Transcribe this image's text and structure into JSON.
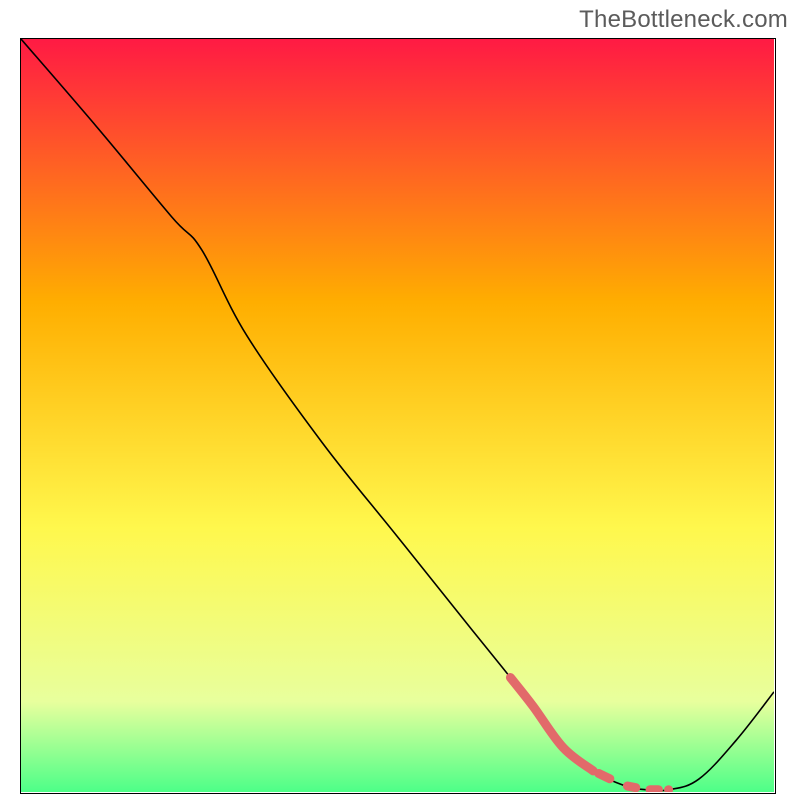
{
  "watermark": "TheBottleneck.com",
  "chart_data": {
    "type": "line",
    "title": "",
    "xlabel": "",
    "ylabel": "",
    "xlim": [
      0,
      100
    ],
    "ylim": [
      0,
      100
    ],
    "grid": false,
    "background": "gradient",
    "gradient_colors": [
      "#ff1a44",
      "#ffae00",
      "#fff84d",
      "#e8ff9d",
      "#4dff88"
    ],
    "series": [
      {
        "name": "curve",
        "type": "line",
        "color": "#000000",
        "x": [
          0,
          10,
          20,
          24,
          30,
          40,
          50,
          60,
          65,
          68,
          72,
          76,
          80,
          83,
          86,
          90,
          95,
          100
        ],
        "y": [
          100,
          88.4,
          76.4,
          72,
          60.6,
          46.4,
          33.9,
          21.4,
          15.2,
          11.4,
          5.9,
          2.8,
          0.9,
          0.3,
          0.3,
          1.7,
          6.9,
          13.3
        ]
      },
      {
        "name": "highlight",
        "type": "line",
        "color": "#e26a6a",
        "style": "thick-dash-dot",
        "x": [
          65,
          68,
          72,
          76,
          80,
          83,
          86
        ],
        "y": [
          15.2,
          11.4,
          5.9,
          2.8,
          0.9,
          0.3,
          0.3
        ]
      }
    ]
  }
}
